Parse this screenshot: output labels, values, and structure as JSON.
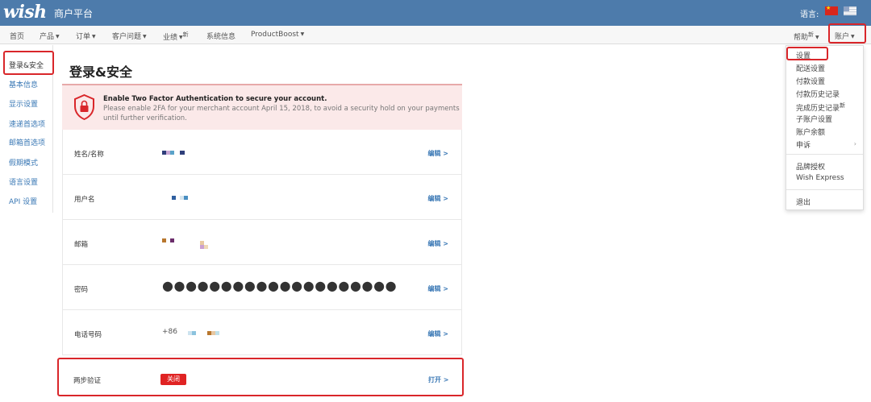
{
  "topbar": {
    "logo": "wish",
    "platform": "商户平台",
    "language_label": "语言:",
    "flags": [
      "cn-flag-icon",
      "us-flag-icon"
    ]
  },
  "nav": {
    "home": "首页",
    "products": "产品",
    "orders": "订单",
    "customer_issues": "客户问题",
    "performance": "业绩",
    "performance_badge": "新",
    "system_info": "系统信息",
    "product_boost": "ProductBoost",
    "help": "帮助",
    "help_badge": "新",
    "account": "账户"
  },
  "sidebar": {
    "items": [
      {
        "label": "登录&安全"
      },
      {
        "label": "基本信息"
      },
      {
        "label": "显示设置"
      },
      {
        "label": "速递首选项"
      },
      {
        "label": "邮箱首选项"
      },
      {
        "label": "假期模式"
      },
      {
        "label": "语言设置"
      },
      {
        "label": "API 设置"
      }
    ]
  },
  "main": {
    "title": "登录&安全",
    "alert": {
      "title": "Enable Two Factor Authentication to secure your account.",
      "line1": "Please enable 2FA for your merchant account April 15, 2018, to avoid a security hold on your payments",
      "line2": "until further verification."
    },
    "rows": [
      {
        "label": "姓名/名称",
        "edit": "编辑 >"
      },
      {
        "label": "用户名",
        "edit": "编辑 >"
      },
      {
        "label": "邮箱",
        "edit": "编辑 >"
      },
      {
        "label": "密码",
        "value": "●●●●●●●●●●●●●●●●●●●●",
        "edit": "编辑 >"
      },
      {
        "label": "电话号码",
        "value": "+86",
        "edit": "编辑 >"
      }
    ],
    "two_factor": {
      "label": "两步验证",
      "status": "关闭",
      "action": "打开 >"
    }
  },
  "dropdown": {
    "items": [
      {
        "label": "设置"
      },
      {
        "label": "配送设置"
      },
      {
        "label": "付款设置"
      },
      {
        "label": "付款历史记录"
      },
      {
        "label": "完成历史记录",
        "badge": "新"
      },
      {
        "label": "子账户设置"
      },
      {
        "label": "账户余额"
      },
      {
        "label": "申诉"
      },
      {
        "label": "品牌授权"
      },
      {
        "label": "Wish Express"
      },
      {
        "label": "退出"
      }
    ]
  },
  "colors": {
    "topbar": "#4d7bab",
    "link": "#3a78b5",
    "alert_bg": "#fbe9e9",
    "danger": "#e02323",
    "highlight": "#d9262a"
  }
}
